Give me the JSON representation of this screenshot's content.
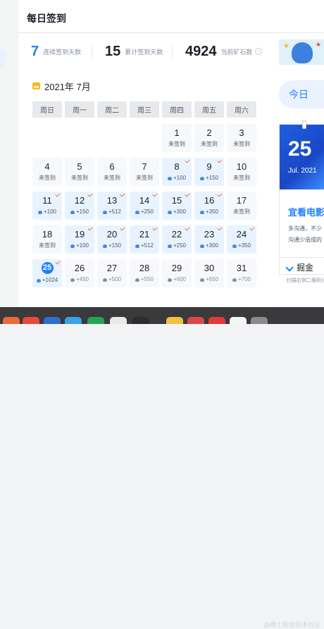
{
  "header": {
    "title": "每日签到"
  },
  "stats": [
    {
      "value": "7",
      "label": "连续签到天数"
    },
    {
      "value": "15",
      "label": "累计签到天数"
    },
    {
      "value": "4924",
      "label": "当前矿石数"
    }
  ],
  "calendar": {
    "month_label": "2021年 7月",
    "weekdays": [
      "周日",
      "周一",
      "周二",
      "周三",
      "周四",
      "周五",
      "周六"
    ],
    "days": [
      {
        "day": "1",
        "status": "未签到",
        "type": "unsigned"
      },
      {
        "day": "2",
        "status": "未签到",
        "type": "unsigned"
      },
      {
        "day": "3",
        "status": "未签到",
        "type": "unsigned"
      },
      {
        "day": "4",
        "status": "未签到",
        "type": "unsigned"
      },
      {
        "day": "5",
        "status": "未签到",
        "type": "unsigned"
      },
      {
        "day": "6",
        "status": "未签到",
        "type": "unsigned"
      },
      {
        "day": "7",
        "status": "未签到",
        "type": "unsigned"
      },
      {
        "day": "8",
        "status": "+100",
        "type": "signed"
      },
      {
        "day": "9",
        "status": "+150",
        "type": "signed"
      },
      {
        "day": "10",
        "status": "未签到",
        "type": "unsigned"
      },
      {
        "day": "11",
        "status": "+100",
        "type": "signed"
      },
      {
        "day": "12",
        "status": "+150",
        "type": "signed"
      },
      {
        "day": "13",
        "status": "+512",
        "type": "signed"
      },
      {
        "day": "14",
        "status": "+250",
        "type": "signed"
      },
      {
        "day": "15",
        "status": "+300",
        "type": "signed"
      },
      {
        "day": "16",
        "status": "+350",
        "type": "signed"
      },
      {
        "day": "17",
        "status": "未签到",
        "type": "unsigned"
      },
      {
        "day": "18",
        "status": "未签到",
        "type": "unsigned"
      },
      {
        "day": "19",
        "status": "+100",
        "type": "signed"
      },
      {
        "day": "20",
        "status": "+150",
        "type": "signed"
      },
      {
        "day": "21",
        "status": "+512",
        "type": "signed"
      },
      {
        "day": "22",
        "status": "+250",
        "type": "signed"
      },
      {
        "day": "23",
        "status": "+300",
        "type": "signed"
      },
      {
        "day": "24",
        "status": "+350",
        "type": "signed"
      },
      {
        "day": "25",
        "status": "+1024",
        "type": "today"
      },
      {
        "day": "26",
        "status": "+450",
        "type": "future"
      },
      {
        "day": "27",
        "status": "+500",
        "type": "future"
      },
      {
        "day": "28",
        "status": "+550",
        "type": "future"
      },
      {
        "day": "29",
        "status": "+600",
        "type": "future"
      },
      {
        "day": "30",
        "status": "+650",
        "type": "future"
      },
      {
        "day": "31",
        "status": "+700",
        "type": "future"
      }
    ]
  },
  "side": {
    "today_button": "今日",
    "calendar_day": "25",
    "calendar_month": "Jul. 2021",
    "card_title": "宜看电影",
    "card_desc_1": "多沟通，不少",
    "card_desc_2": "沟通少造成的",
    "brand": "掘金",
    "scan_text": "扫描右侧二维码分享"
  },
  "watermark": "@稀土掘金技术社区",
  "colors": {
    "accent": "#1e80ff",
    "check": "#f77234",
    "signed_bg": "#e8f3ff",
    "unsigned_bg": "#f7f8fa"
  }
}
